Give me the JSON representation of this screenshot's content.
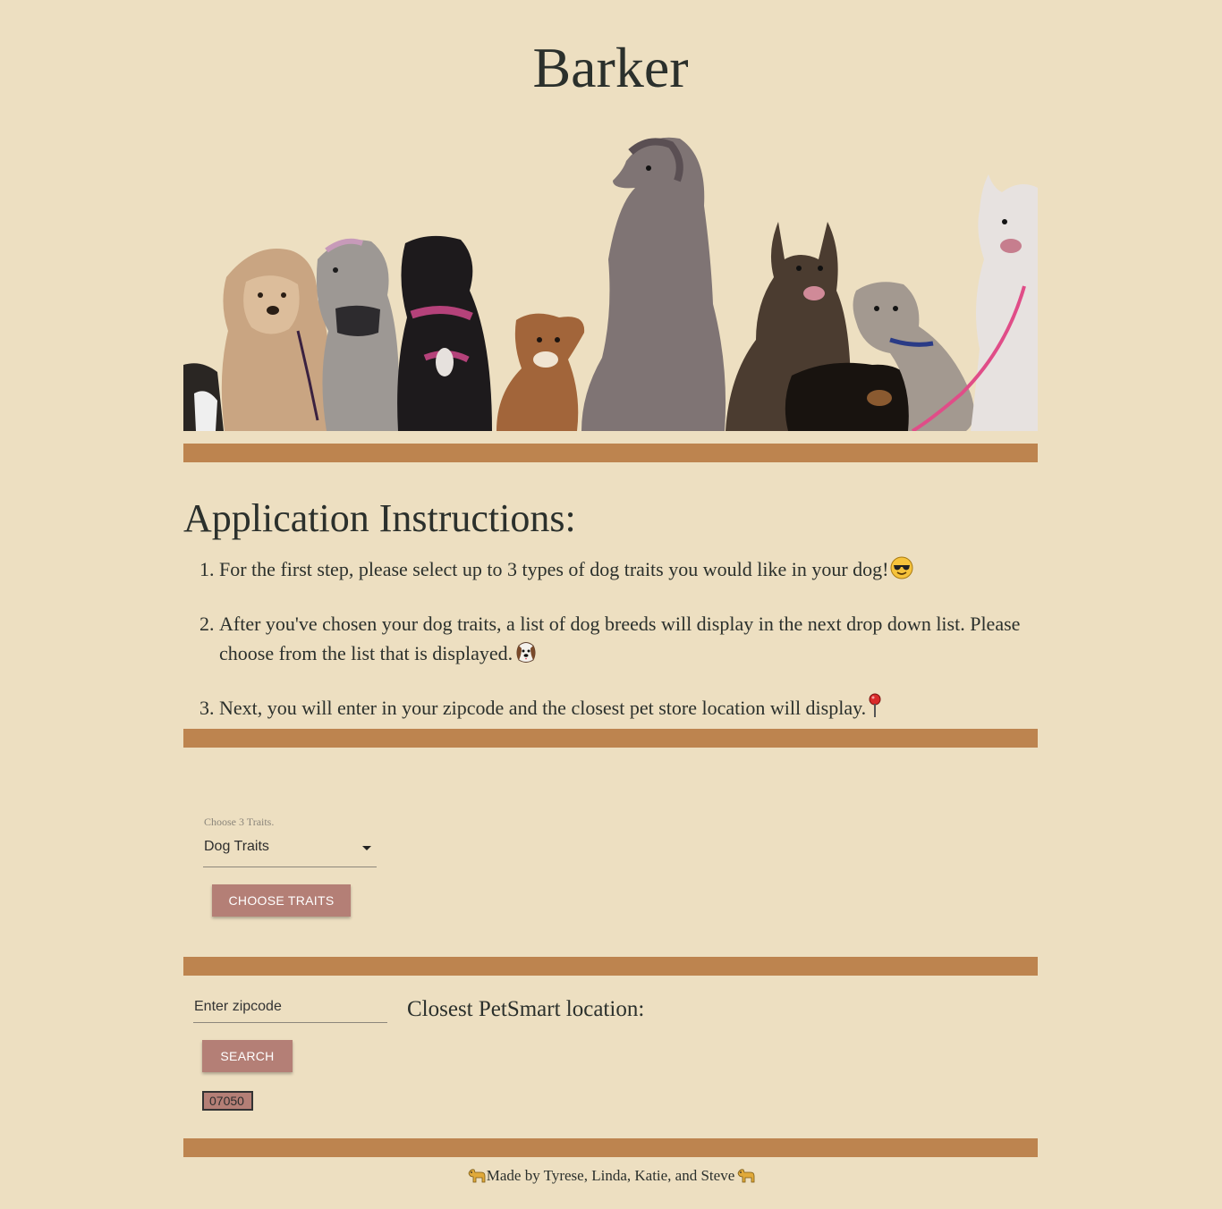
{
  "header": {
    "title": "Barker"
  },
  "instructions": {
    "heading": "Application Instructions:",
    "steps": [
      "For the first step, please select up to 3 types of dog traits you would like in your dog!",
      "After you've chosen your dog traits, a list of dog breeds will display in the next drop down list. Please choose from the list that is displayed.",
      "Next, you will enter in your zipcode and the closest pet store location will display."
    ]
  },
  "traits": {
    "label": "Choose 3 Traits.",
    "selected": "Dog Traits",
    "button": "CHOOSE TRAITS"
  },
  "location": {
    "zip_placeholder": "Enter zipcode",
    "search_button": "SEARCH",
    "zip_value": "07050",
    "closest_heading": "Closest PetSmart location:"
  },
  "footer": {
    "text": "Made by Tyrese, Linda, Katie, and Steve"
  },
  "colors": {
    "background": "#eddfc1",
    "divider": "#bd844f",
    "button": "#b47f76",
    "text": "#2b302c"
  }
}
